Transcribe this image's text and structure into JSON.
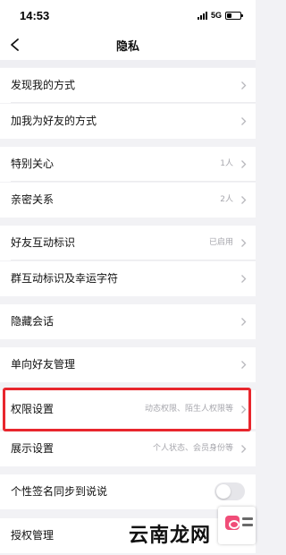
{
  "status_bar": {
    "time": "14:53",
    "network": "5G",
    "battery_level": 0.35
  },
  "nav": {
    "title": "隐私",
    "back_icon": "chevron-left-icon"
  },
  "rows": [
    {
      "label": "发现我的方式",
      "value": ""
    },
    {
      "label": "加我为好友的方式",
      "value": ""
    },
    {
      "label": "特别关心",
      "value": "1人"
    },
    {
      "label": "亲密关系",
      "value": "2人"
    },
    {
      "label": "好友互动标识",
      "value": "已启用"
    },
    {
      "label": "群互动标识及幸运字符",
      "value": ""
    },
    {
      "label": "隐藏会话",
      "value": ""
    },
    {
      "label": "单向好友管理",
      "value": ""
    },
    {
      "label": "权限设置",
      "value": "动态权限、陌生人权限等"
    },
    {
      "label": "展示设置",
      "value": "个人状态、会员身份等"
    },
    {
      "label": "个性签名同步到说说",
      "toggle_on": false
    },
    {
      "label": "授权管理",
      "value": ""
    }
  ],
  "annotation": {
    "highlight_color": "#e8262d"
  },
  "watermark": {
    "text": "云南龙网"
  }
}
